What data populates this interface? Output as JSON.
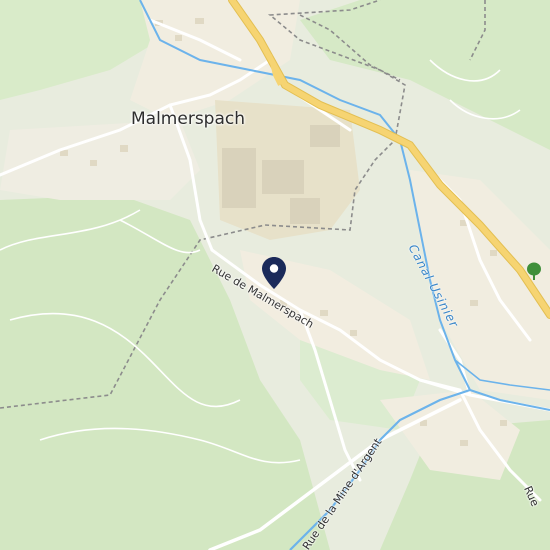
{
  "map": {
    "labels": {
      "town": "Malmerspach",
      "street_1": "Rue de Malmerspach",
      "street_2": "Rue de la Mine d'Argent",
      "street_3": "Rue",
      "waterway": "Canal Usinier"
    },
    "icons": {
      "location_pin": "map-pin-icon",
      "poi": "tree-icon"
    },
    "colors": {
      "background": "#eef0e6",
      "forest": "#d6e9c6",
      "residential": "#f2ede0",
      "industrial": "#e9e3cc",
      "water": "#5aa9e6",
      "highway": "#f6d472",
      "boundary": "#8a8a8a",
      "pin": "#1b2a5a"
    }
  }
}
